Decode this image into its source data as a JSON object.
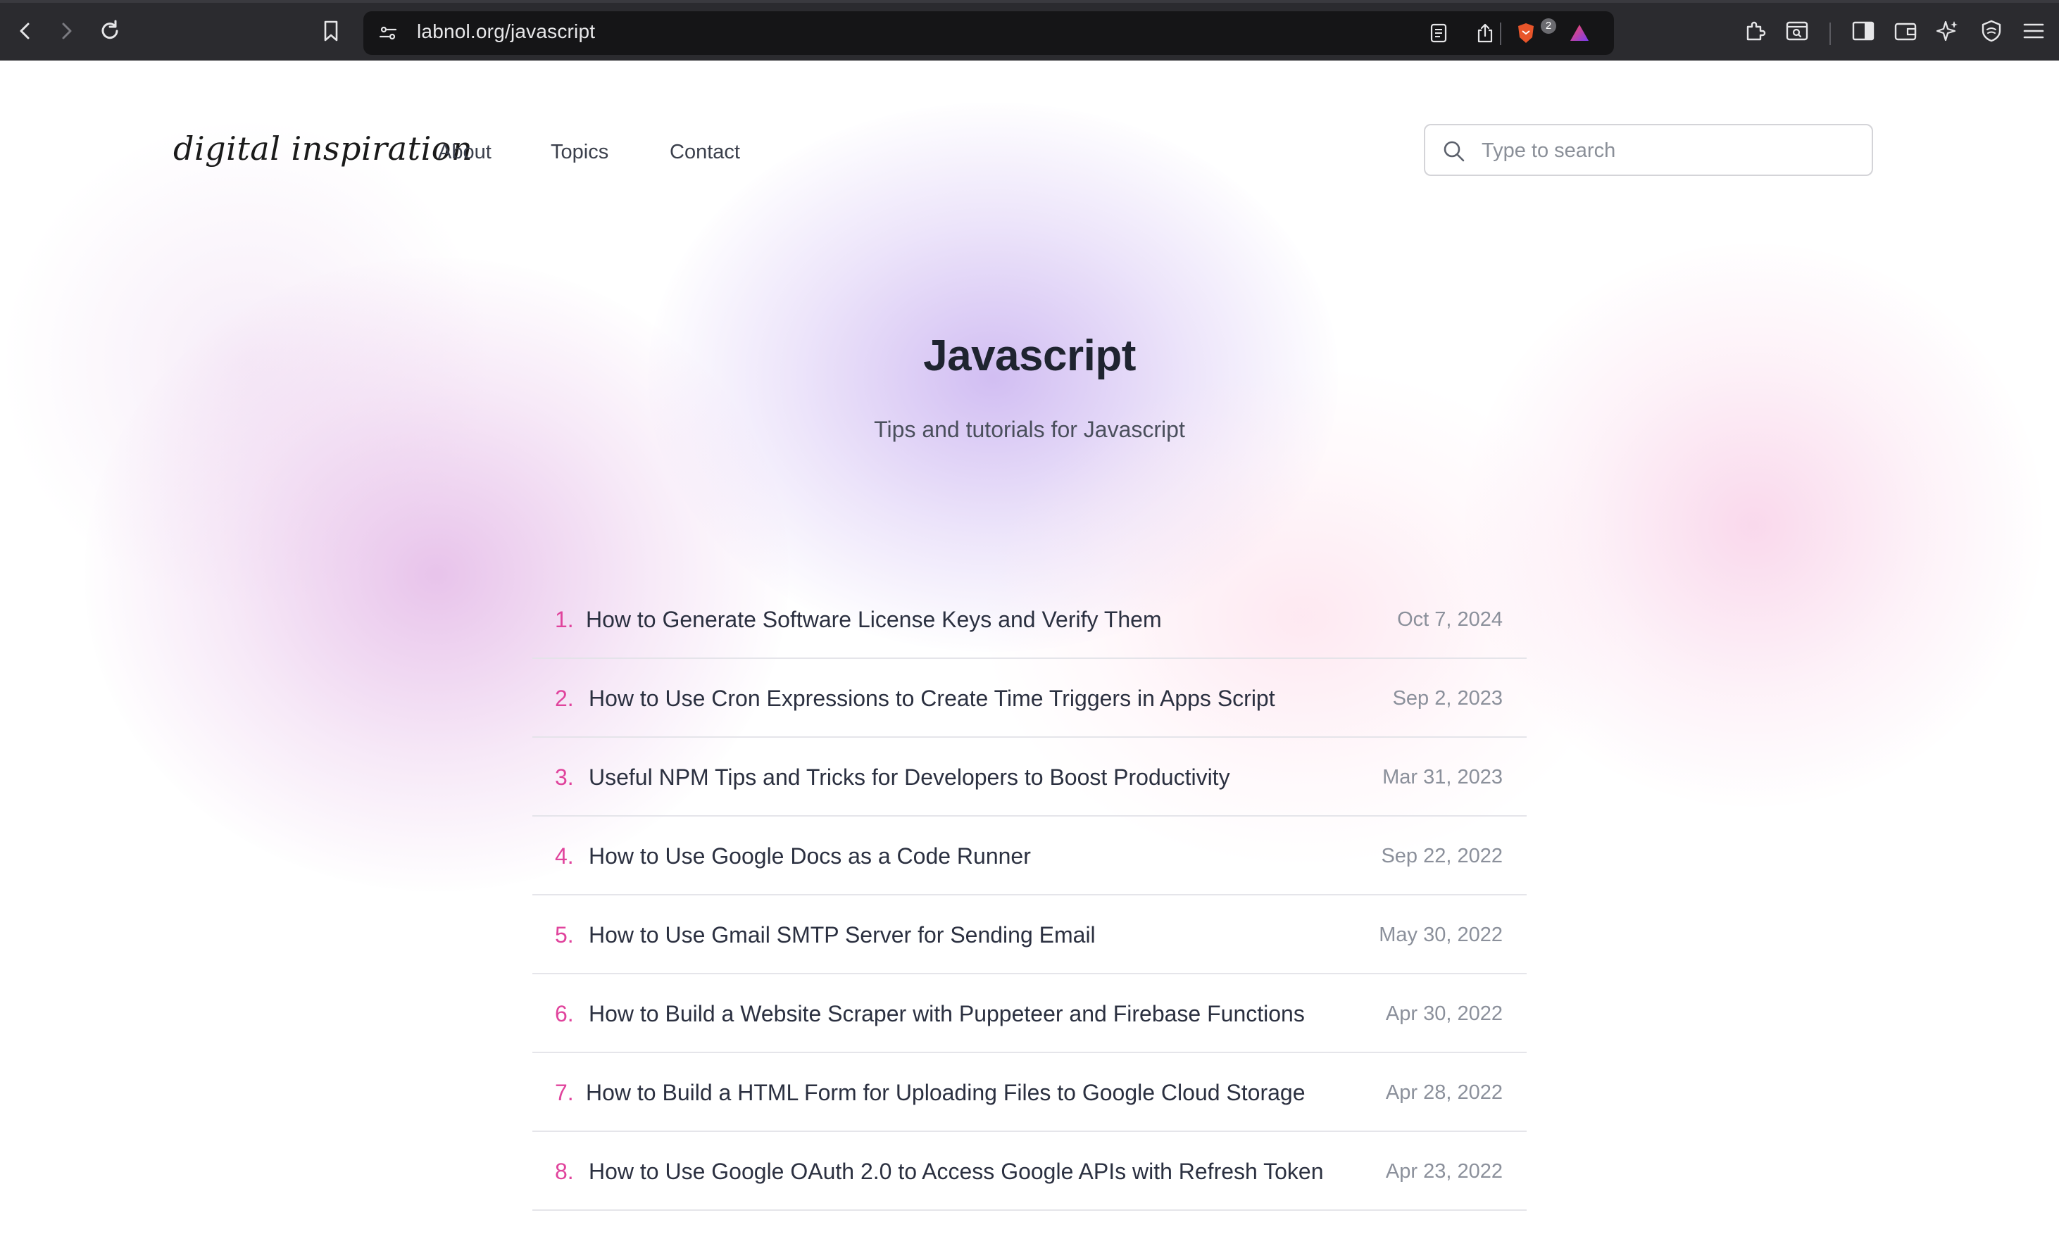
{
  "browser": {
    "url": "labnol.org/javascript",
    "shield_badge": "2"
  },
  "site": {
    "logo": "digital inspiration",
    "nav": [
      "About",
      "Topics",
      "Contact"
    ],
    "search_placeholder": "Type to search"
  },
  "hero": {
    "title": "Javascript",
    "subtitle": "Tips and tutorials for Javascript"
  },
  "articles": [
    {
      "num": "1.",
      "title": "How to Generate Software License Keys and Verify Them",
      "date": "Oct 7, 2024"
    },
    {
      "num": "2.",
      "title": "How to Use Cron Expressions to Create Time Triggers in Apps Script",
      "date": "Sep 2, 2023"
    },
    {
      "num": "3.",
      "title": "Useful NPM Tips and Tricks for Developers to Boost Productivity",
      "date": "Mar 31, 2023"
    },
    {
      "num": "4.",
      "title": "How to Use Google Docs as a Code Runner",
      "date": "Sep 22, 2022"
    },
    {
      "num": "5.",
      "title": "How to Use Gmail SMTP Server for Sending Email",
      "date": "May 30, 2022"
    },
    {
      "num": "6.",
      "title": "How to Build a Website Scraper with Puppeteer and Firebase Functions",
      "date": "Apr 30, 2022"
    },
    {
      "num": "7.",
      "title": "How to Build a HTML Form for Uploading Files to Google Cloud Storage",
      "date": "Apr 28, 2022"
    },
    {
      "num": "8.",
      "title": "How to Use Google OAuth 2.0 to Access Google APIs with Refresh Token",
      "date": "Apr 23, 2022"
    }
  ],
  "colors": {
    "accent_number": "#e0439c",
    "chrome_bg": "#2b2b2f",
    "urlbar_bg": "#151517"
  }
}
